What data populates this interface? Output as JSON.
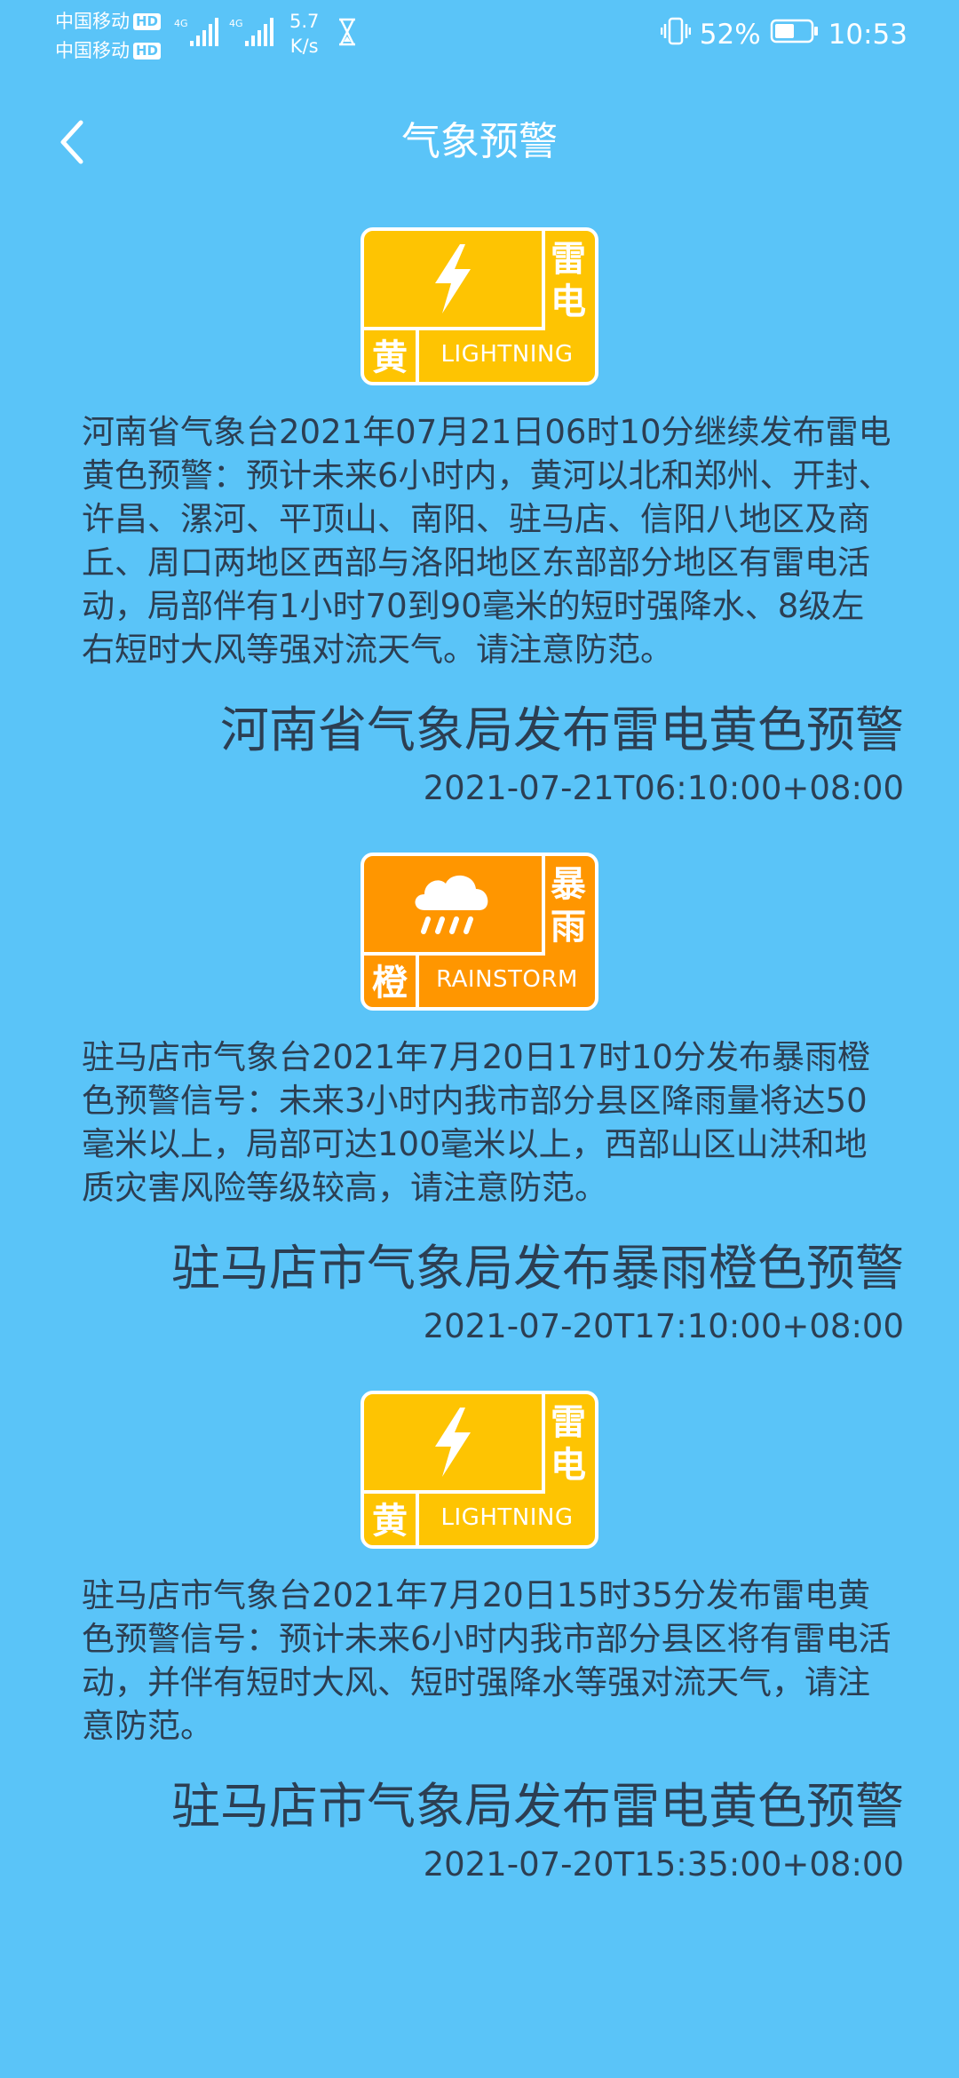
{
  "status_bar": {
    "carrier1": "中国移动",
    "carrier2": "中国移动",
    "hd": "HD",
    "net1": "4G",
    "net2": "4G",
    "speed_value": "5.7",
    "speed_unit": "K/s",
    "battery": "52%",
    "time": "10:53"
  },
  "header": {
    "title": "气象预警"
  },
  "warnings": [
    {
      "icon": "lightning-icon",
      "type_chars": [
        "雷",
        "电"
      ],
      "level_char": "黄",
      "type_en": "LIGHTNING",
      "color": "#fec402",
      "description": "河南省气象台2021年07月21日06时10分继续发布雷电黄色预警：预计未来6小时内，黄河以北和郑州、开封、许昌、漯河、平顶山、南阳、驻马店、信阳八地区及商丘、周口两地区西部与洛阳地区东部部分地区有雷电活动，局部伴有1小时70到90毫米的短时强降水、8级左右短时大风等强对流天气。请注意防范。",
      "headline": "河南省气象局发布雷电黄色预警",
      "time": "2021-07-21T06:10:00+08:00"
    },
    {
      "icon": "rain-cloud-icon",
      "type_chars": [
        "暴",
        "雨"
      ],
      "level_char": "橙",
      "type_en": "RAINSTORM",
      "color": "#ff9600",
      "description": "驻马店市气象台2021年7月20日17时10分发布暴雨橙色预警信号：未来3小时内我市部分县区降雨量将达50毫米以上，局部可达100毫米以上，西部山区山洪和地质灾害风险等级较高，请注意防范。",
      "headline": "驻马店市气象局发布暴雨橙色预警",
      "time": "2021-07-20T17:10:00+08:00"
    },
    {
      "icon": "lightning-icon",
      "type_chars": [
        "雷",
        "电"
      ],
      "level_char": "黄",
      "type_en": "LIGHTNING",
      "color": "#fec402",
      "description": "驻马店市气象台2021年7月20日15时35分发布雷电黄色预警信号：预计未来6小时内我市部分县区将有雷电活动，并伴有短时大风、短时强降水等强对流天气，请注意防范。",
      "headline": "驻马店市气象局发布雷电黄色预警",
      "time": "2021-07-20T15:35:00+08:00"
    }
  ]
}
